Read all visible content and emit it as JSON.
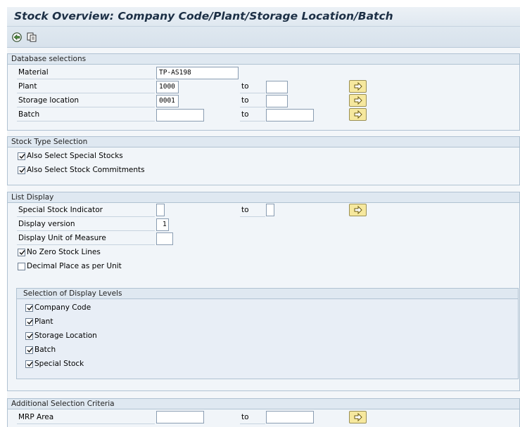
{
  "title": "Stock Overview: Company Code/Plant/Storage Location/Batch",
  "toolbar": {
    "execute_icon": "execute-icon",
    "variant_icon": "get-variant-icon"
  },
  "db_selections": {
    "header": "Database selections",
    "to_label": "to",
    "rows": [
      {
        "label": "Material",
        "from": "TP-AS198"
      },
      {
        "label": "Plant",
        "from": "1000",
        "to": ""
      },
      {
        "label": "Storage location",
        "from": "0001",
        "to": ""
      },
      {
        "label": "Batch",
        "from": "",
        "to": ""
      }
    ]
  },
  "stock_type": {
    "header": "Stock Type Selection",
    "options": [
      {
        "label": "Also Select Special Stocks",
        "checked": true
      },
      {
        "label": "Also Select Stock Commitments",
        "checked": true
      }
    ]
  },
  "list_display": {
    "header": "List Display",
    "special_stock_label": "Special Stock Indicator",
    "special_stock_from": "",
    "special_stock_to": "",
    "to_label": "to",
    "display_version_label": "Display version",
    "display_version_value": "1",
    "uom_label": "Display Unit of Measure",
    "uom_value": "",
    "no_zero_label": "No Zero Stock Lines",
    "no_zero_checked": true,
    "decimal_label": "Decimal Place as per Unit",
    "decimal_checked": false,
    "levels_header": "Selection of Display Levels",
    "levels": [
      {
        "label": "Company Code",
        "checked": true
      },
      {
        "label": "Plant",
        "checked": true
      },
      {
        "label": "Storage Location",
        "checked": true
      },
      {
        "label": "Batch",
        "checked": true
      },
      {
        "label": "Special Stock",
        "checked": true
      }
    ]
  },
  "additional": {
    "header": "Additional Selection Criteria",
    "mrp_label": "MRP Area",
    "mrp_from": "",
    "mrp_to": "",
    "to_label": "to"
  },
  "colors": {
    "title_text": "#1c2f45",
    "arrow_button": "#f6e89e",
    "group_header": "#dfe8f1"
  }
}
